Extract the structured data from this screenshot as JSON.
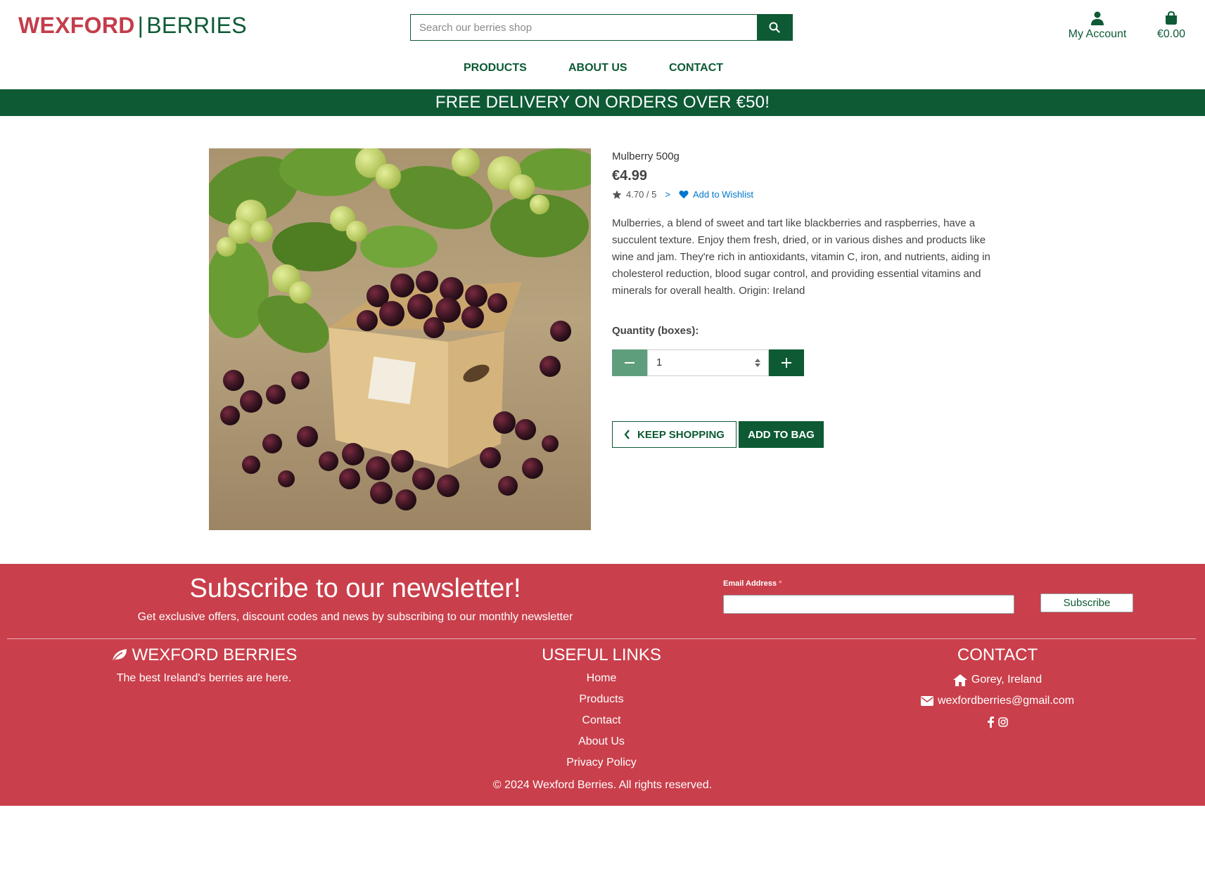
{
  "header": {
    "logo_left": "WEXFORD",
    "logo_sep": "|",
    "logo_right": "BERRIES",
    "search_placeholder": "Search our berries shop",
    "account_label": "My Account",
    "bag_total": "€0.00"
  },
  "nav": {
    "items": [
      "PRODUCTS",
      "ABOUT US",
      "CONTACT"
    ]
  },
  "banner": {
    "text": "FREE DELIVERY ON ORDERS OVER €50!"
  },
  "product": {
    "name": "Mulberry 500g",
    "price": "€4.99",
    "rating": "4.70 / 5",
    "rating_sep": ">",
    "wishlist_label": "Add to Wishlist",
    "description": "Mulberries, a blend of sweet and tart like blackberries and raspberries, have a succulent texture. Enjoy them fresh, dried, or in various dishes and products like wine and jam. They're rich in antioxidants, vitamin C, iron, and nutrients, aiding in cholesterol reduction, blood sugar control, and providing essential vitamins and minerals for overall health. Origin: Ireland",
    "quantity_label": "Quantity (boxes):",
    "quantity_value": "1",
    "keep_shopping_label": "KEEP SHOPPING",
    "add_to_bag_label": "ADD TO BAG"
  },
  "newsletter": {
    "title": "Subscribe to our newsletter!",
    "subtitle": "Get exclusive offers, discount codes and news by subscribing to our monthly newsletter",
    "email_label": "Email Address",
    "required_mark": "*",
    "subscribe_label": "Subscribe"
  },
  "footer": {
    "brand_title": "WEXFORD BERRIES",
    "brand_tagline": "The best Ireland's berries are here.",
    "links_title": "USEFUL LINKS",
    "links": [
      "Home",
      "Products",
      "Contact",
      "About Us",
      "Privacy Policy"
    ],
    "contact_title": "CONTACT",
    "location": "Gorey, Ireland",
    "email": "wexfordberries@gmail.com",
    "copyright": "© 2024 Wexford Berries. All rights reserved."
  },
  "colors": {
    "brand_green": "#0d5a34",
    "brand_red": "#c43c4a",
    "footer_red": "#c93f4b",
    "link_blue": "#0077cc"
  },
  "icons": [
    "search-icon",
    "user-icon",
    "shopping-bag-icon",
    "star-icon",
    "heart-icon",
    "minus-icon",
    "plus-icon",
    "chevron-left-icon",
    "leaf-icon",
    "home-icon",
    "envelope-icon",
    "facebook-icon",
    "instagram-icon"
  ]
}
